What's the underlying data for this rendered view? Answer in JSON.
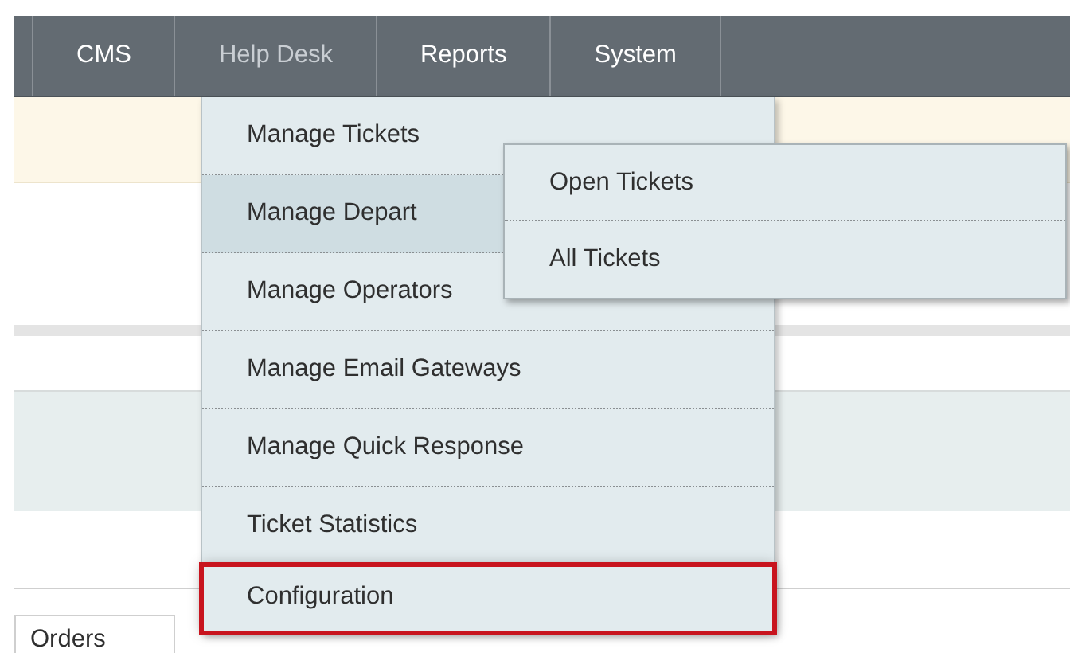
{
  "nav": [
    {
      "label": "CMS",
      "selected": false
    },
    {
      "label": "Help Desk",
      "selected": true
    },
    {
      "label": "Reports",
      "selected": false
    },
    {
      "label": "System",
      "selected": false
    }
  ],
  "menu": [
    {
      "label": "Manage Tickets",
      "selected": false,
      "highlighted": false
    },
    {
      "label": "Manage Depart",
      "selected": true,
      "highlighted": false
    },
    {
      "label": "Manage Operators",
      "selected": false,
      "highlighted": false
    },
    {
      "label": "Manage Email Gateways",
      "selected": false,
      "highlighted": false
    },
    {
      "label": "Manage Quick Response",
      "selected": false,
      "highlighted": false
    },
    {
      "label": "Ticket Statistics",
      "selected": false,
      "highlighted": false
    },
    {
      "label": "Configuration",
      "selected": false,
      "highlighted": true
    }
  ],
  "submenu": [
    {
      "label": "Open Tickets"
    },
    {
      "label": "All Tickets"
    }
  ],
  "tabs": [
    {
      "label": "Orders"
    }
  ]
}
